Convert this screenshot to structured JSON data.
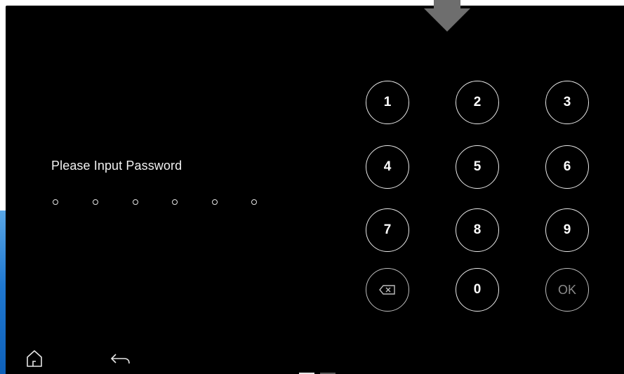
{
  "prompt": {
    "text": "Please Input Password"
  },
  "password_dots": {
    "count": 6,
    "filled": 0
  },
  "keypad": {
    "keys": [
      "1",
      "2",
      "3",
      "4",
      "5",
      "6",
      "7",
      "8",
      "9",
      "⌫",
      "0",
      "OK"
    ],
    "ok_label": "OK",
    "zero_label": "0"
  },
  "navigation": {
    "home_icon": "home-icon",
    "back_icon": "back-arrow-icon"
  },
  "page_indicator": {
    "pages": 2,
    "active": 1
  },
  "colors": {
    "background": "#000000",
    "foreground": "#ffffff",
    "accent_blue": "#1f78d1",
    "arrow_gray": "#6e6e6e",
    "muted": "#8a8a8a"
  }
}
